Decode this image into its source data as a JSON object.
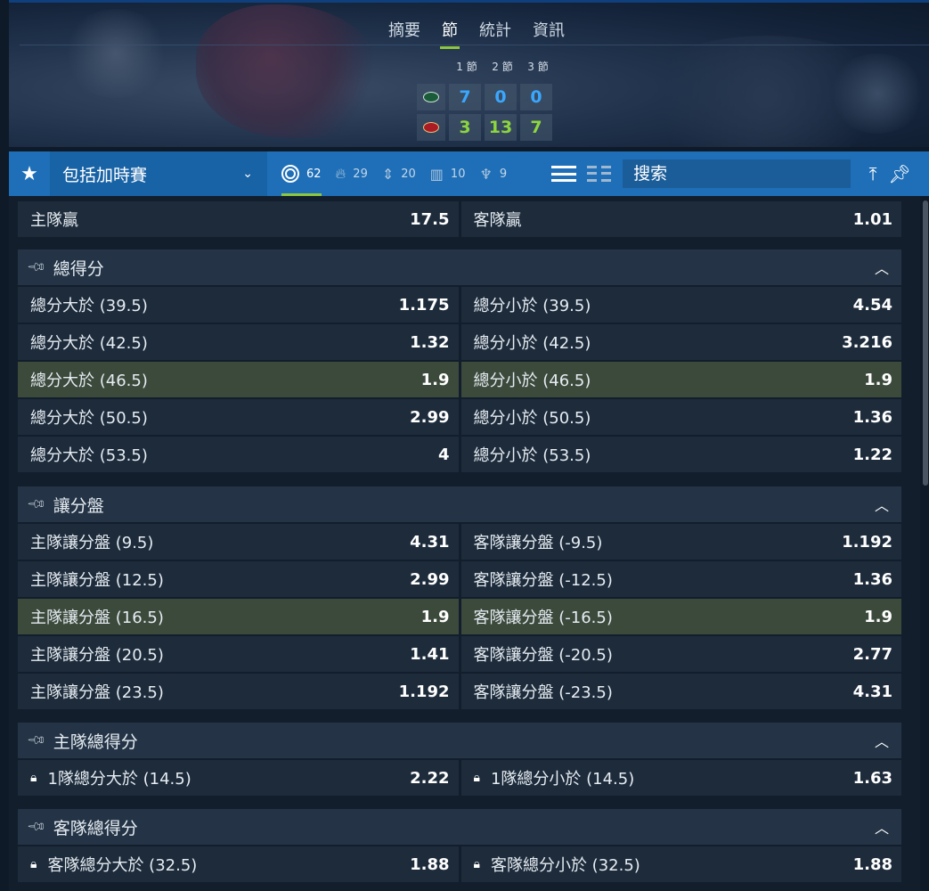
{
  "tabs": [
    "摘要",
    "節",
    "統計",
    "資訊"
  ],
  "active_tab": 1,
  "scoreboard": {
    "periods": [
      "1 節",
      "2 節",
      "3 節"
    ],
    "teams": [
      {
        "logo": "jets-logo",
        "color": "#1a5b3a",
        "scores": [
          "7",
          "0",
          "0"
        ]
      },
      {
        "logo": "49ers-logo",
        "color": "#aa1b23",
        "scores": [
          "3",
          "13",
          "7"
        ]
      }
    ]
  },
  "toolbar": {
    "favorite_icon": "star-icon",
    "filter_selected": "包括加時賽",
    "stats": [
      {
        "icon": "target-icon",
        "count": "62",
        "active": true
      },
      {
        "icon": "fire-icon",
        "count": "29"
      },
      {
        "icon": "updown-icon",
        "count": "20"
      },
      {
        "icon": "bar-icon",
        "count": "10"
      },
      {
        "icon": "trophy-icon",
        "count": "9"
      }
    ],
    "search_placeholder": "搜索"
  },
  "moneyline": {
    "home_label": "主隊贏",
    "home_odds": "17.5",
    "away_label": "客隊贏",
    "away_odds": "1.01"
  },
  "sections": {
    "total": {
      "title": "總得分",
      "rows": [
        {
          "l": "總分大於 (39.5)",
          "lo": "1.175",
          "r": "總分小於 (39.5)",
          "ro": "4.54"
        },
        {
          "l": "總分大於 (42.5)",
          "lo": "1.32",
          "r": "總分小於 (42.5)",
          "ro": "3.216"
        },
        {
          "l": "總分大於 (46.5)",
          "lo": "1.9",
          "r": "總分小於 (46.5)",
          "ro": "1.9"
        },
        {
          "l": "總分大於 (50.5)",
          "lo": "2.99",
          "r": "總分小於 (50.5)",
          "ro": "1.36"
        },
        {
          "l": "總分大於 (53.5)",
          "lo": "4",
          "r": "總分小於 (53.5)",
          "ro": "1.22"
        }
      ]
    },
    "handicap": {
      "title": "讓分盤",
      "rows": [
        {
          "l": "主隊讓分盤 (9.5)",
          "lo": "4.31",
          "r": "客隊讓分盤 (-9.5)",
          "ro": "1.192"
        },
        {
          "l": "主隊讓分盤 (12.5)",
          "lo": "2.99",
          "r": "客隊讓分盤 (-12.5)",
          "ro": "1.36"
        },
        {
          "l": "主隊讓分盤 (16.5)",
          "lo": "1.9",
          "r": "客隊讓分盤 (-16.5)",
          "ro": "1.9"
        },
        {
          "l": "主隊讓分盤 (20.5)",
          "lo": "1.41",
          "r": "客隊讓分盤 (-20.5)",
          "ro": "2.77"
        },
        {
          "l": "主隊讓分盤 (23.5)",
          "lo": "1.192",
          "r": "客隊讓分盤 (-23.5)",
          "ro": "4.31"
        }
      ]
    },
    "home_total": {
      "title": "主隊總得分",
      "rows": [
        {
          "l": "1隊總分大於 (14.5)",
          "lo": "2.22",
          "r": "1隊總分小於 (14.5)",
          "ro": "1.63"
        }
      ]
    },
    "away_total": {
      "title": "客隊總得分",
      "rows": [
        {
          "l": "客隊總分大於 (32.5)",
          "lo": "1.88",
          "r": "客隊總分小於 (32.5)",
          "ro": "1.88"
        }
      ]
    }
  },
  "colors": {
    "toolbar_blue": "#1e6fb8",
    "accent_green": "#8dc63f",
    "home_score": "#3aa7ff",
    "away_score": "#8dd63f",
    "highlight_row": "#3c4a3c"
  }
}
